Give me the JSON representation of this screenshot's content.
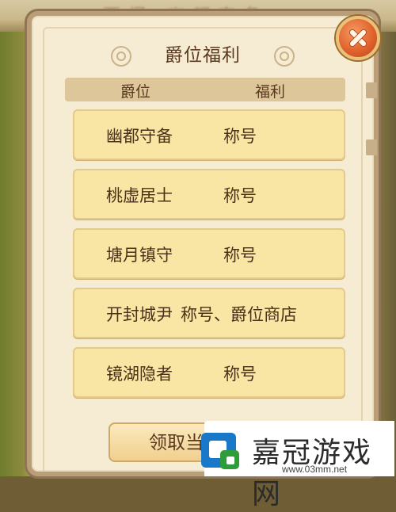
{
  "background": {
    "blurred_title": "西门·幽都守备"
  },
  "dialog": {
    "title": "爵位福利",
    "header": {
      "rank_col": "爵位",
      "benefit_col": "福利"
    },
    "rows": [
      {
        "rank": "幽都守备",
        "benefit": "称号"
      },
      {
        "rank": "桃虚居士",
        "benefit": "称号"
      },
      {
        "rank": "塘月镇守",
        "benefit": "称号"
      },
      {
        "rank": "开封城尹",
        "benefit": "称号、爵位商店"
      },
      {
        "rank": "镜湖隐者",
        "benefit": "称号"
      }
    ],
    "claim_button": "领取当前爵位奖励",
    "close_icon": "close-x-icon"
  },
  "watermark": {
    "brand": "嘉冠游戏网",
    "url": "www.03mm.net"
  },
  "colors": {
    "accent": "#e2632d",
    "row_bg": "#fae6a4",
    "panel_bg": "#f6ecd4",
    "text": "#4a3118"
  }
}
